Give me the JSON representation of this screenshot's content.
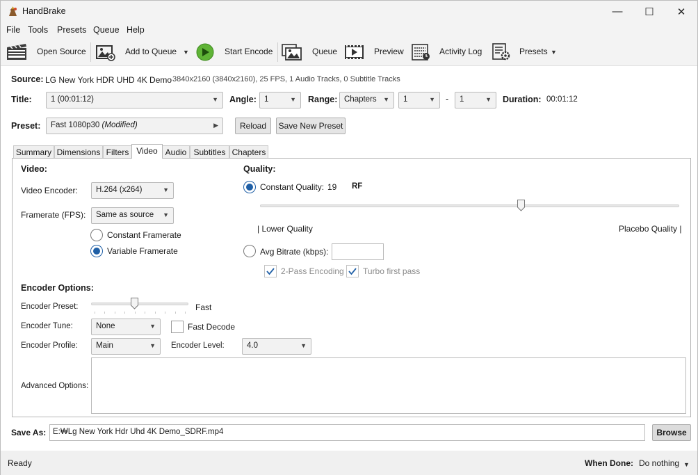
{
  "window": {
    "title": "HandBrake",
    "minimize_glyph": "—",
    "maximize_glyph": "☐",
    "close_glyph": "✕"
  },
  "menu": [
    "File",
    "Tools",
    "Presets",
    "Queue",
    "Help"
  ],
  "toolbar": {
    "open_source": "Open Source",
    "add_to_queue": "Add to Queue",
    "start_encode": "Start Encode",
    "queue": "Queue",
    "preview": "Preview",
    "activity_log": "Activity Log",
    "presets": "Presets"
  },
  "source": {
    "label": "Source:",
    "name": "LG New York HDR UHD 4K Demo",
    "info": "3840x2160 (3840x2160), 25 FPS, 1 Audio Tracks, 0 Subtitle Tracks"
  },
  "title_row": {
    "title_label": "Title:",
    "title_value": "1  (00:01:12)",
    "angle_label": "Angle:",
    "angle_value": "1",
    "range_label": "Range:",
    "range_type": "Chapters",
    "range_from": "1",
    "range_dash": "-",
    "range_to": "1",
    "duration_label": "Duration:",
    "duration_value": "00:01:12"
  },
  "preset_row": {
    "label": "Preset:",
    "name": "Fast 1080p30",
    "modified": "(Modified)",
    "reload": "Reload",
    "save_new": "Save New Preset"
  },
  "tabs": [
    "Summary",
    "Dimensions",
    "Filters",
    "Video",
    "Audio",
    "Subtitles",
    "Chapters"
  ],
  "active_tab": "Video",
  "video": {
    "heading": "Video:",
    "encoder_label": "Video Encoder:",
    "encoder_value": "H.264 (x264)",
    "framerate_label": "Framerate (FPS):",
    "framerate_value": "Same as source",
    "constant_framerate": "Constant Framerate",
    "variable_framerate": "Variable Framerate",
    "variable_selected": true
  },
  "quality": {
    "heading": "Quality:",
    "constant_quality_label": "Constant Quality:",
    "rf_value": "19",
    "rf_unit": "RF",
    "slider_fraction": 0.625,
    "lower_label": "| Lower Quality",
    "placebo_label": "Placebo Quality |",
    "avg_bitrate_label": "Avg Bitrate (kbps):",
    "avg_bitrate_value": "",
    "two_pass": "2-Pass Encoding",
    "turbo": "Turbo first pass",
    "two_pass_checked": true,
    "turbo_checked": true
  },
  "encoder_options": {
    "heading": "Encoder Options:",
    "preset_label": "Encoder Preset:",
    "preset_value": "Fast",
    "preset_fraction": 0.44,
    "tune_label": "Encoder Tune:",
    "tune_value": "None",
    "fast_decode": "Fast Decode",
    "profile_label": "Encoder Profile:",
    "profile_value": "Main",
    "level_label": "Encoder Level:",
    "level_value": "4.0",
    "advanced_label": "Advanced Options:",
    "advanced_value": ""
  },
  "save_as": {
    "label": "Save As:",
    "path": "E:₩Lg New York Hdr Uhd 4K Demo_SDRF.mp4",
    "browse": "Browse"
  },
  "status": {
    "text": "Ready",
    "when_done_label": "When Done:",
    "when_done_value": "Do nothing"
  },
  "colors": {
    "accent": "#1f5fa6",
    "start_green": "#5fb336"
  }
}
